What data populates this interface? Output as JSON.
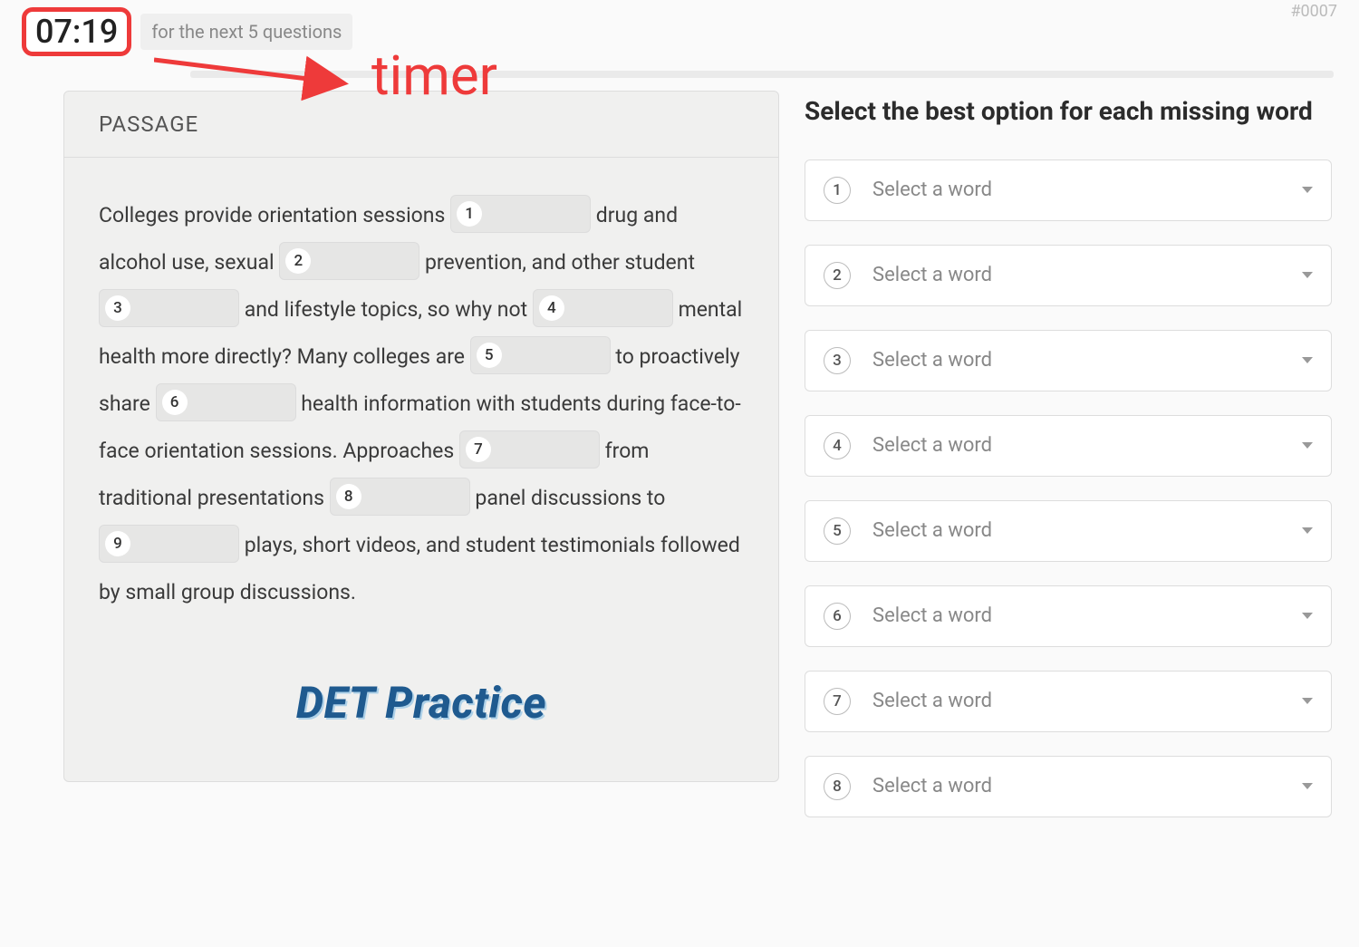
{
  "header": {
    "timer": "07:19",
    "timer_note": "for the next 5 questions",
    "question_id": "#0007"
  },
  "annotation": {
    "label": "timer"
  },
  "passage": {
    "heading": "PASSAGE",
    "segments": [
      "Colleges provide orientation sessions ",
      " drug and alcohol use, sexual ",
      " prevention, and other student ",
      " and lifestyle topics, so why not ",
      " mental health more directly? Many colleges are ",
      " to proactively share ",
      " health information with students during face-to-face orientation sessions. Approaches ",
      " from traditional presentations ",
      " panel discussions to ",
      " plays, short videos, and student testimonials followed by small group discussions."
    ],
    "blank_numbers": [
      "1",
      "2",
      "3",
      "4",
      "5",
      "6",
      "7",
      "8",
      "9"
    ],
    "brand": "DET Practice"
  },
  "right": {
    "instruction": "Select the best option for each missing word",
    "placeholder": "Select a word",
    "options": [
      {
        "n": "1"
      },
      {
        "n": "2"
      },
      {
        "n": "3"
      },
      {
        "n": "4"
      },
      {
        "n": "5"
      },
      {
        "n": "6"
      },
      {
        "n": "7"
      },
      {
        "n": "8"
      }
    ]
  }
}
